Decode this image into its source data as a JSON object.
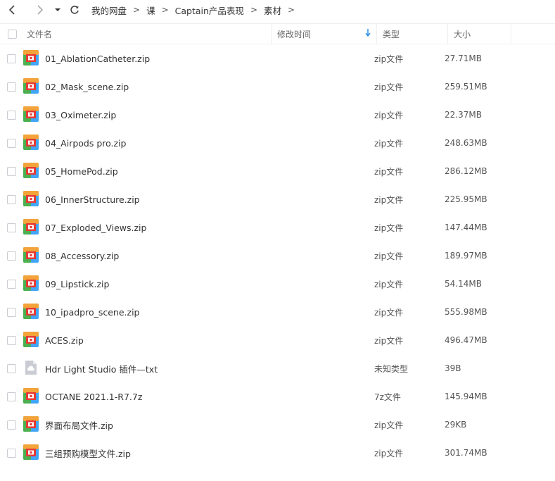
{
  "nav": {
    "breadcrumb": [
      "我的网盘",
      "课",
      "Captain产品表现",
      "素材"
    ],
    "separator": ">"
  },
  "header": {
    "name": "文件名",
    "modified": "修改时间",
    "type": "类型",
    "size": "大小"
  },
  "colors": {
    "accent": "#1e88e5",
    "zip_icon_top": "#f3a33a",
    "zip_icon_left": "#4caf50",
    "zip_icon_right": "#42a5f5",
    "zip_icon_center": "#e53935",
    "unknown_icon": "#c9cdd3"
  },
  "files": [
    {
      "name": "01_AblationCatheter.zip",
      "type": "zip文件",
      "size": "27.71MB",
      "icon": "zip-icon"
    },
    {
      "name": "02_Mask_scene.zip",
      "type": "zip文件",
      "size": "259.51MB",
      "icon": "zip-icon"
    },
    {
      "name": "03_Oximeter.zip",
      "type": "zip文件",
      "size": "22.37MB",
      "icon": "zip-icon"
    },
    {
      "name": "04_Airpods pro.zip",
      "type": "zip文件",
      "size": "248.63MB",
      "icon": "zip-icon"
    },
    {
      "name": "05_HomePod.zip",
      "type": "zip文件",
      "size": "286.12MB",
      "icon": "zip-icon"
    },
    {
      "name": "06_InnerStructure.zip",
      "type": "zip文件",
      "size": "225.95MB",
      "icon": "zip-icon"
    },
    {
      "name": "07_Exploded_Views.zip",
      "type": "zip文件",
      "size": "147.44MB",
      "icon": "zip-icon"
    },
    {
      "name": "08_Accessory.zip",
      "type": "zip文件",
      "size": "189.97MB",
      "icon": "zip-icon"
    },
    {
      "name": "09_Lipstick.zip",
      "type": "zip文件",
      "size": "54.14MB",
      "icon": "zip-icon"
    },
    {
      "name": "10_ipadpro_scene.zip",
      "type": "zip文件",
      "size": "555.98MB",
      "icon": "zip-icon"
    },
    {
      "name": "ACES.zip",
      "type": "zip文件",
      "size": "496.47MB",
      "icon": "zip-icon"
    },
    {
      "name": "Hdr Light Studio 插件—txt",
      "type": "未知类型",
      "size": "39B",
      "icon": "unknown-file-icon"
    },
    {
      "name": "OCTANE 2021.1-R7.7z",
      "type": "7z文件",
      "size": "145.94MB",
      "icon": "zip-icon"
    },
    {
      "name": "界面布局文件.zip",
      "type": "zip文件",
      "size": "29KB",
      "icon": "zip-icon"
    },
    {
      "name": "三组预购模型文件.zip",
      "type": "zip文件",
      "size": "301.74MB",
      "icon": "zip-icon"
    }
  ]
}
